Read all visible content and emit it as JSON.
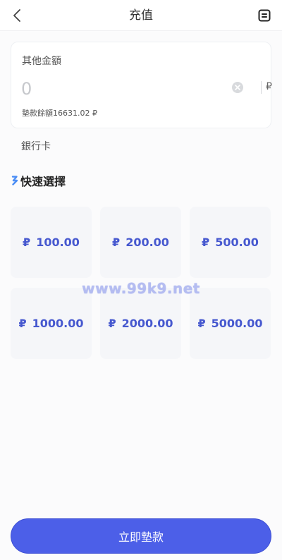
{
  "header": {
    "title": "充值",
    "back_icon": "chevron-left-icon",
    "record_icon": "document-list-icon"
  },
  "amount_card": {
    "label": "其他金額",
    "input_value": "",
    "input_placeholder": "0",
    "currency_symbol": "₽",
    "balance_text": "墊款餘額16631.02 ₽",
    "clear_icon": "clear-circle-icon"
  },
  "bank": {
    "label": "銀行卡"
  },
  "quick_select": {
    "title": "快速選擇",
    "icon": "brand-s-icon",
    "currency_symbol": "₽",
    "options": [
      {
        "amount": "100.00"
      },
      {
        "amount": "200.00"
      },
      {
        "amount": "500.00"
      },
      {
        "amount": "1000.00"
      },
      {
        "amount": "2000.00"
      },
      {
        "amount": "5000.00"
      }
    ]
  },
  "watermark": "www.99k9.net",
  "submit": {
    "label": "立即墊款"
  },
  "colors": {
    "accent": "#4c5fe8",
    "option_text": "#4658cf",
    "option_bg": "#f5f6f9"
  }
}
